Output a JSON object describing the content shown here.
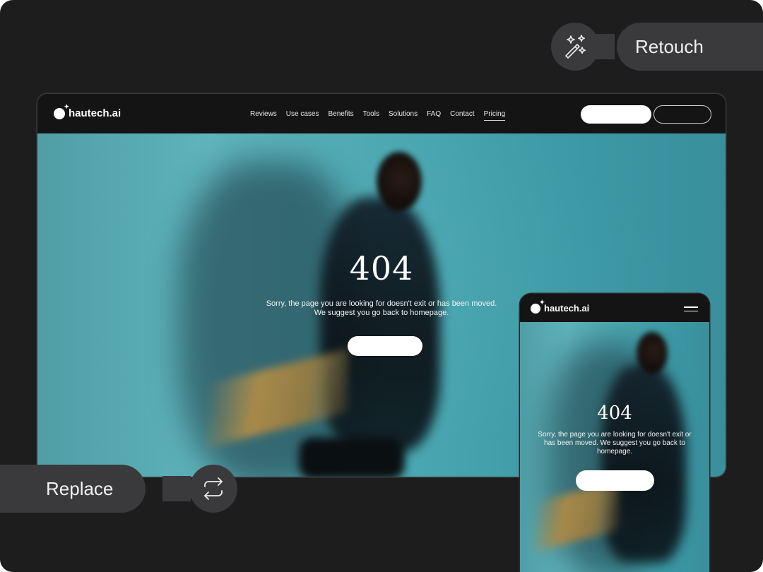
{
  "brand": {
    "name": "hautech.ai"
  },
  "nav": {
    "items": [
      "Reviews",
      "Use cases",
      "Benefits",
      "Tools",
      "Solutions",
      "FAQ",
      "Contact",
      "Pricing"
    ],
    "active_item": "Pricing"
  },
  "desktop_page": {
    "title": "404",
    "message_line1": "Sorry, the page you are looking for doesn't exit or has been moved.",
    "message_line2": "We suggest you go back to homepage."
  },
  "mobile_page": {
    "title": "404",
    "message": "Sorry, the page you are looking for doesn't exit or has been moved. We suggest you go back to homepage."
  },
  "badges": {
    "retouch": {
      "label": "Retouch",
      "icon": "magic-wand-icon"
    },
    "replace": {
      "label": "Replace",
      "icon": "swap-arrows-icon"
    }
  },
  "colors": {
    "background": "#1d1d1e",
    "pill": "#3a3a3c",
    "hero_teal": "#4aa6b0"
  }
}
